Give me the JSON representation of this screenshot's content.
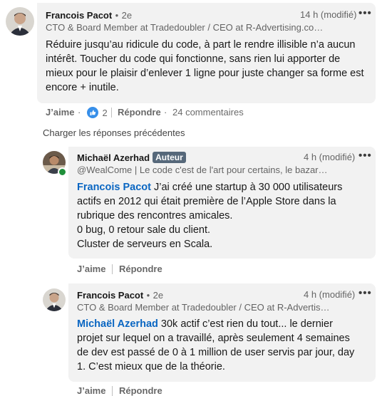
{
  "comment1": {
    "author": "Francois Pacot",
    "degree": "2e",
    "headline": "CTO & Board Member at Tradedoubler / CEO at R-Advertising.com / ...",
    "time": "14 h (modifié)",
    "text": "Réduire jusqu’au ridicule du code, à part le rendre illisible n’a aucun intérêt. Toucher du code qui fonctionne, sans rien lui apporter de mieux pour le plaisir d’enlever 1 ligne pour juste changer sa forme est encore + inutile.",
    "like_label": "J’aime",
    "reaction_count": "2",
    "reply_label": "Répondre",
    "comments_count": "24 commentaires"
  },
  "load_previous": "Charger les réponses précédentes",
  "reply1": {
    "author": "Michaël Azerhad",
    "badge": "Auteur",
    "headline": "@WealCome | Le code c'est de l'art pour certains, le bazar p...",
    "time": "4 h (modifié)",
    "mention": "Francois Pacot",
    "text": " J’ai créé une startup à 30 000 utilisateurs actifs en 2012 qui était première de l’Apple Store dans la rubrique des rencontres amicales.",
    "line2": "0 bug, 0 retour sale du client.",
    "line3": "Cluster de serveurs en Scala.",
    "like_label": "J’aime",
    "reply_label": "Répondre"
  },
  "reply2": {
    "author": "Francois Pacot",
    "degree": "2e",
    "headline": "CTO & Board Member at Tradedoubler / CEO at R-Advertisin...",
    "time": "4 h (modifié)",
    "mention": "Michaël Azerhad",
    "text": " 30k actif c’est rien du tout... le dernier projet sur lequel on a travaillé, après seulement 4 semaines de dev est passé de 0 à 1 million de user servis par jour, day 1. C’est mieux que de la théorie.",
    "like_label": "J’aime",
    "reply_label": "Répondre"
  },
  "icons": {
    "more": "more-horizontal-icon",
    "like": "thumbs-up-reaction-icon"
  },
  "colors": {
    "link": "#0a66c2",
    "bubble": "#f2f2f2",
    "badge": "#56687a"
  }
}
